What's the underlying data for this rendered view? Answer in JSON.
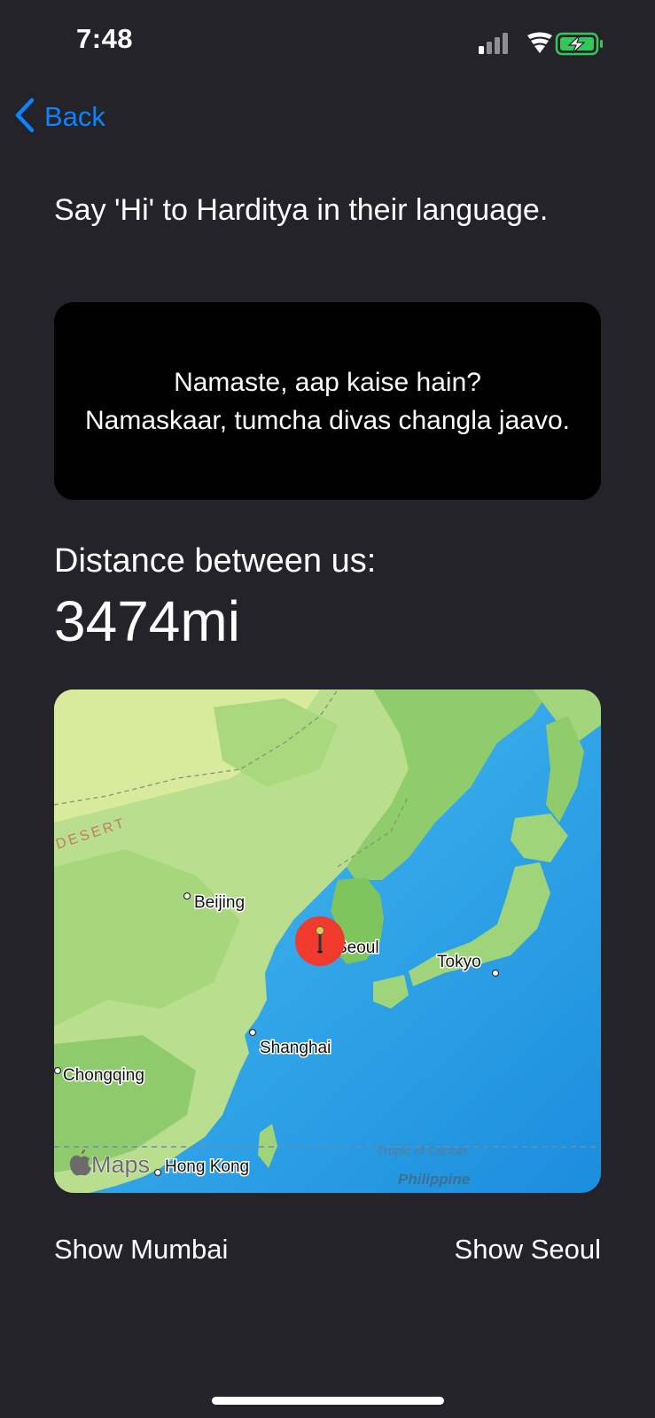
{
  "status_bar": {
    "time": "7:48"
  },
  "nav": {
    "back_label": "Back"
  },
  "prompt": "Say 'Hi' to Harditya in their language.",
  "phrases": [
    "Namaste, aap kaise hain?",
    "Namaskaar, tumcha divas changla jaavo."
  ],
  "distance": {
    "label": "Distance between us:",
    "value": "3474mi"
  },
  "map": {
    "labels": {
      "desert": "DESERT",
      "beijing": "Beijing",
      "seoul": "Seoul",
      "tokyo": "Tokyo",
      "shanghai": "Shanghai",
      "chongqing": "Chongqing",
      "hong_kong": "Hong Kong",
      "tropic": "Tropic of Cancer",
      "philippine": "Philippine",
      "maps_brand": "Maps"
    },
    "pin_color": "#f03a2e"
  },
  "buttons": {
    "show_left": "Show Mumbai",
    "show_right": "Show Seoul"
  },
  "colors": {
    "accent": "#0a84ff",
    "background": "#24232a"
  }
}
